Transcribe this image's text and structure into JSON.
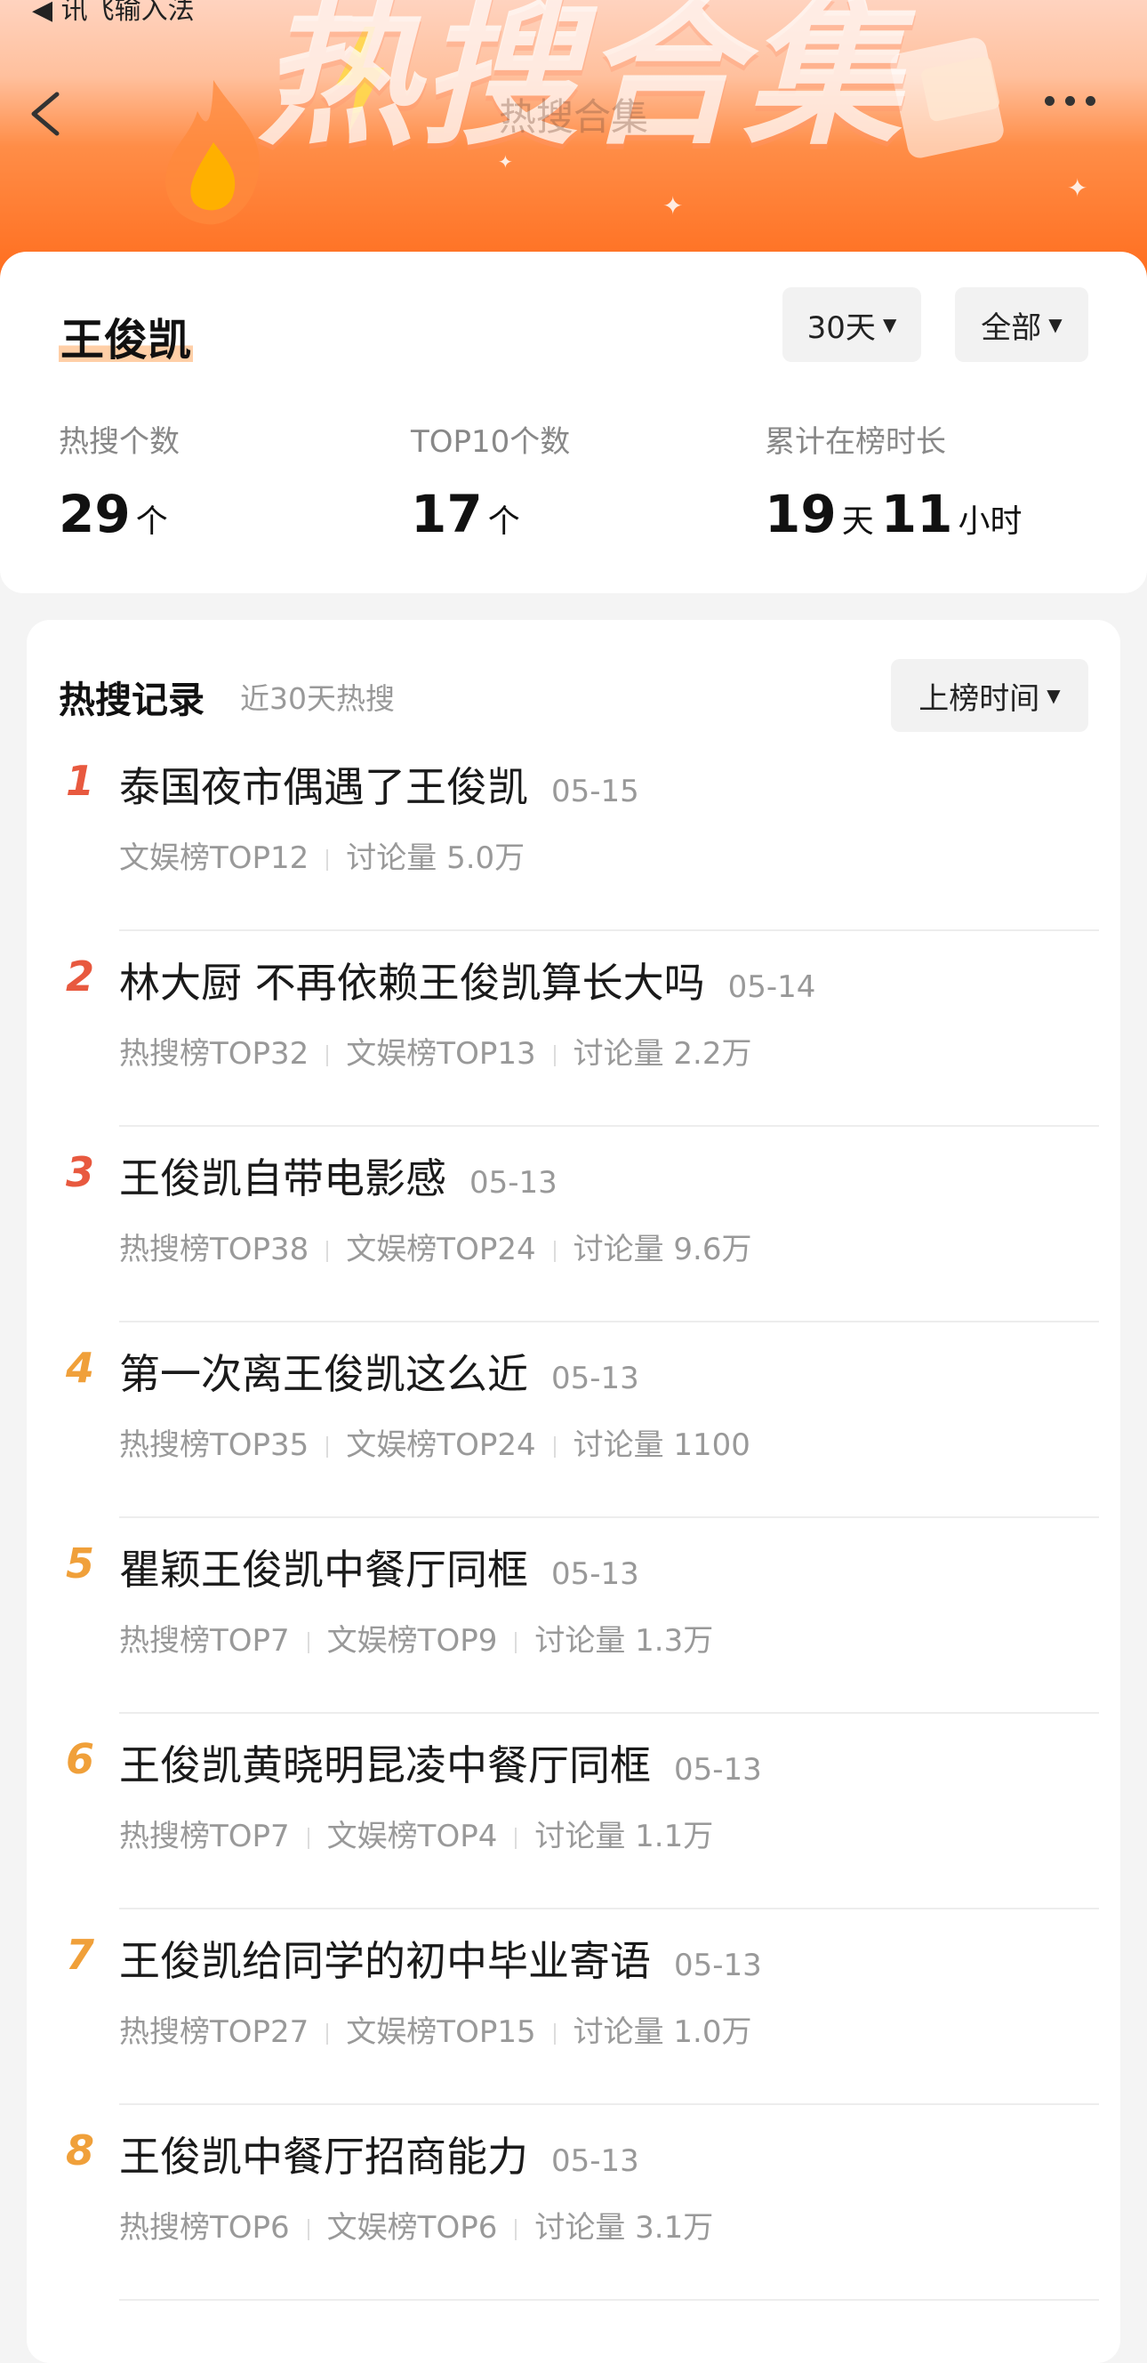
{
  "status_bar": {
    "text": "◀ 讯飞输入法"
  },
  "header": {
    "banner": "热搜合集",
    "title": "热搜合集"
  },
  "summary": {
    "name": "王俊凯",
    "range_filter": "30天",
    "scope_filter": "全部",
    "stats": [
      {
        "label": "热搜个数",
        "value": "29",
        "unit": "个"
      },
      {
        "label": "TOP10个数",
        "value": "17",
        "unit": "个"
      },
      {
        "label": "累计在榜时长",
        "days": "19",
        "days_unit": "天",
        "hours": "11",
        "hours_unit": "小时"
      }
    ]
  },
  "records": {
    "title": "热搜记录",
    "subtitle": "近30天热搜",
    "sort_label": "上榜时间",
    "items": [
      {
        "rank": "1",
        "title": "泰国夜市偶遇了王俊凯",
        "date": "05-15",
        "meta": [
          "文娱榜TOP12",
          "讨论量 5.0万"
        ]
      },
      {
        "rank": "2",
        "title": "林大厨 不再依赖王俊凯算长大吗",
        "date": "05-14",
        "meta": [
          "热搜榜TOP32",
          "文娱榜TOP13",
          "讨论量 2.2万"
        ]
      },
      {
        "rank": "3",
        "title": "王俊凯自带电影感",
        "date": "05-13",
        "meta": [
          "热搜榜TOP38",
          "文娱榜TOP24",
          "讨论量 9.6万"
        ]
      },
      {
        "rank": "4",
        "title": "第一次离王俊凯这么近",
        "date": "05-13",
        "meta": [
          "热搜榜TOP35",
          "文娱榜TOP24",
          "讨论量 1100"
        ]
      },
      {
        "rank": "5",
        "title": "瞿颖王俊凯中餐厅同框",
        "date": "05-13",
        "meta": [
          "热搜榜TOP7",
          "文娱榜TOP9",
          "讨论量 1.3万"
        ]
      },
      {
        "rank": "6",
        "title": "王俊凯黄晓明昆凌中餐厅同框",
        "date": "05-13",
        "meta": [
          "热搜榜TOP7",
          "文娱榜TOP4",
          "讨论量 1.1万"
        ]
      },
      {
        "rank": "7",
        "title": "王俊凯给同学的初中毕业寄语",
        "date": "05-13",
        "meta": [
          "热搜榜TOP27",
          "文娱榜TOP15",
          "讨论量 1.0万"
        ]
      },
      {
        "rank": "8",
        "title": "王俊凯中餐厅招商能力",
        "date": "05-13",
        "meta": [
          "热搜榜TOP6",
          "文娱榜TOP6",
          "讨论量 3.1万"
        ]
      }
    ]
  },
  "colors": {
    "rank_top3": "#e8593f",
    "rank_rest": "#f0a03a",
    "accent_highlight": "#ffcfa7"
  }
}
